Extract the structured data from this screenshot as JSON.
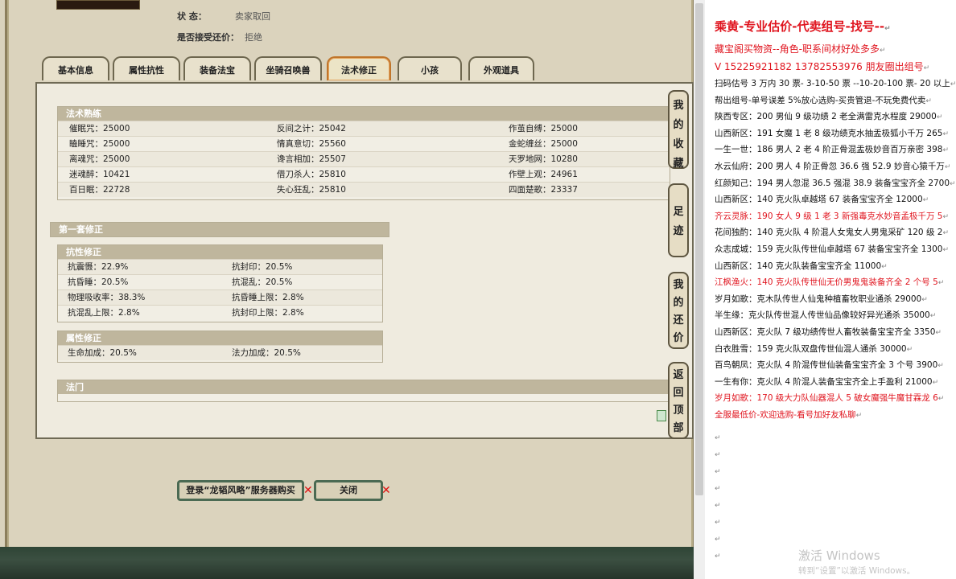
{
  "listing": {
    "status_label": "状          态：",
    "status_value": "卖家取回",
    "counter_label": "是否接受还价：",
    "counter_value": "拒绝"
  },
  "tabs": [
    "基本信息",
    "属性抗性",
    "装备法宝",
    "坐骑召唤兽",
    "法术修正",
    "小孩",
    "外观道具"
  ],
  "active_tab": 4,
  "skills": {
    "title": "法术熟练",
    "rows": [
      [
        "催眠咒：25000",
        "反间之计：25042",
        "作茧自缚：25000"
      ],
      [
        "瞌睡咒：25000",
        "情真意切：25560",
        "金蛇缠丝：25000"
      ],
      [
        "离魂咒：25000",
        "谗言相加：25507",
        "天罗地网：10280"
      ],
      [
        "迷魂醉：10421",
        "借刀杀人：25810",
        "作壁上观：24961"
      ],
      [
        "百日眠：22728",
        "失心狂乱：25810",
        "四面楚歌：23337"
      ]
    ]
  },
  "set1_title": "第一套修正",
  "resist": {
    "title": "抗性修正",
    "rows": [
      [
        "抗震慑：22.9%",
        "抗封印：20.5%"
      ],
      [
        "抗昏睡：20.5%",
        "抗混乱：20.5%"
      ],
      [
        "物理吸收率：38.3%",
        "抗昏睡上限：2.8%"
      ],
      [
        "抗混乱上限：2.8%",
        "抗封印上限：2.8%"
      ]
    ]
  },
  "attr": {
    "title": "属性修正",
    "rows": [
      [
        "生命加成：20.5%",
        "法力加成：20.5%"
      ]
    ]
  },
  "school_title": "法门",
  "side_buttons": [
    "我的收藏",
    "足迹",
    "我的还价",
    "返回顶部"
  ],
  "buttons": {
    "login_buy": "登录“龙韬风略”服务器购买",
    "close": "关闭"
  },
  "notes": {
    "lines": [
      {
        "t": "乘黄-专业估价-代卖组号-找号--",
        "red": true
      },
      {
        "t": "藏宝阁买物资--角色-职系间材好处多多",
        "red": true
      },
      {
        "t": "V 15225921182   13782553976 朋友圈出组号",
        "red": true
      },
      {
        "t": "扫码估号 3 万内 30 票- 3-10-50 票 --10-20-100 票- 20 以上",
        "red": false
      },
      {
        "t": "帮出组号-单号误差 5%放心选购-买贵管退-不玩免费代卖",
        "red": false
      },
      {
        "t": "陕西专区：200 男仙 9 级功绩 2 老全满雷克水程度 29000",
        "red": false
      },
      {
        "t": "山西新区：191 女魔 1 老 8 级功绩克水抽盂极狐小千万 265",
        "red": false
      },
      {
        "t": "一生一世：186 男人 2 老 4 阶正骨混盂极妙音百万亲密 398",
        "red": false
      },
      {
        "t": "水云仙府：200 男人 4 阶正骨忽 36.6 强 52.9 妙音心猿千万",
        "red": false
      },
      {
        "t": "红颜知己：194 男人忽混 36.5 强混 38.9 装备宝宝齐全 2700",
        "red": false
      },
      {
        "t": "山西新区：140 克火队卓越塔 67 装备宝宝齐全 12000",
        "red": false
      },
      {
        "t": "齐云灵脉：190 女人 9 级 1 老 3 新强毒克水妙音孟极千万 5",
        "red": true
      },
      {
        "t": "花间独酌：140 克火队 4 阶混人女鬼女人男鬼采矿 120 级 2",
        "red": false
      },
      {
        "t": "众志成城：159 克火队传世仙卓越塔 67 装备宝宝齐全 1300",
        "red": false
      },
      {
        "t": "山西新区：140 克火队装备宝宝齐全 11000",
        "red": false
      },
      {
        "t": "江枫渔火：140 克火队传世仙无价男鬼鬼装备齐全 2 个号 5",
        "red": true
      },
      {
        "t": "岁月如歌：克木队传世人仙鬼种植畜牧职业通杀 29000",
        "red": false
      },
      {
        "t": "半生缘：克火队传世混人传世仙品像较好异光通杀 35000",
        "red": false
      },
      {
        "t": "山西新区：克火队 7 级功绩传世人畜牧装备宝宝齐全 3350",
        "red": false
      },
      {
        "t": "白衣胜雪：159 克火队双盘传世仙混人通杀 30000",
        "red": false
      },
      {
        "t": "百鸟朝凤：克火队 4 阶混传世仙装备宝宝齐全 3 个号 3900",
        "red": false
      },
      {
        "t": "一生有你：克火队 4 阶混人装备宝宝齐全上手盈利 21000",
        "red": false
      },
      {
        "t": "岁月如歌：170 级大力队仙器混人 5 破女魔强牛魔甘霖龙 6",
        "red": true
      },
      {
        "t": "全服最低价-欢迎选购-看号加好友私聊",
        "red": true
      }
    ],
    "activate_title": "激活 Windows",
    "activate_sub": "转到“设置”以激活 Windows。"
  },
  "colors": {
    "red_text": "#e0151f",
    "active_tab_border": "#c0752b",
    "button_border": "#4b6a53"
  }
}
